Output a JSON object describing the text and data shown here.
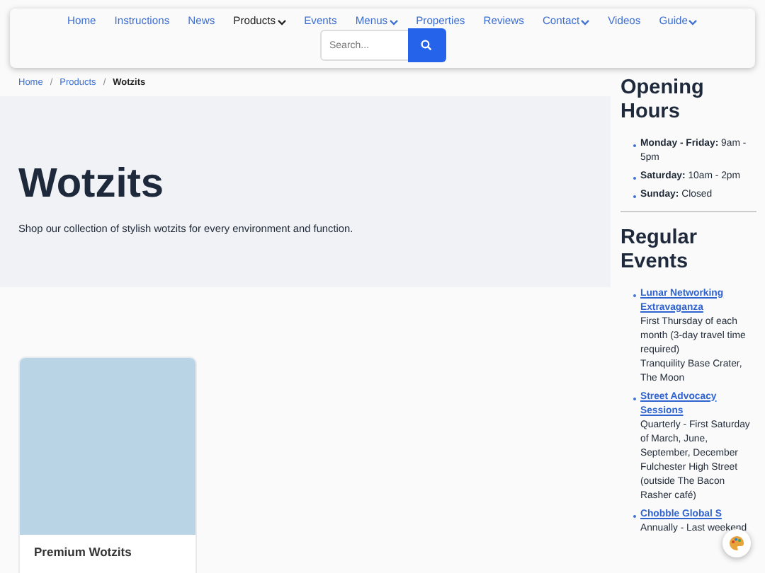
{
  "nav": {
    "items": [
      {
        "label": "Home",
        "selected": false,
        "dropdown": false
      },
      {
        "label": "Instructions",
        "selected": false,
        "dropdown": false
      },
      {
        "label": "News",
        "selected": false,
        "dropdown": false
      },
      {
        "label": "Products",
        "selected": true,
        "dropdown": true
      },
      {
        "label": "Events",
        "selected": false,
        "dropdown": false
      },
      {
        "label": "Menus",
        "selected": false,
        "dropdown": true
      },
      {
        "label": "Properties",
        "selected": false,
        "dropdown": false
      },
      {
        "label": "Reviews",
        "selected": false,
        "dropdown": false
      },
      {
        "label": "Contact",
        "selected": false,
        "dropdown": true
      },
      {
        "label": "Videos",
        "selected": false,
        "dropdown": false
      },
      {
        "label": "Guide",
        "selected": false,
        "dropdown": true
      }
    ],
    "search": {
      "placeholder": "Search..."
    }
  },
  "breadcrumb": [
    {
      "label": "Home",
      "current": false
    },
    {
      "separator": "/",
      "label": "Products",
      "current": false
    },
    {
      "separator": "/",
      "label": "Wotzits",
      "current": true
    }
  ],
  "hero": {
    "title": "Wotzits",
    "text": "Shop our collection of stylish wotzits for every environment and function."
  },
  "products": [
    {
      "kind": "picture",
      "title": "Premium Wotzits"
    }
  ],
  "sidebar": {
    "hours": {
      "title": "Opening Hours",
      "items": [
        "**Monday - Friday:** 9am - 5pm",
        "**Saturday:** 10am - 2pm",
        "**Sunday:** Closed"
      ]
    },
    "events": {
      "title": "Regular Events",
      "items": [
        {
          "title": "Lunar Networking Extravaganza",
          "lines": [
            "First Thursday of each month (3-day travel time required)",
            "Tranquility Base Crater, The Moon"
          ]
        },
        {
          "title": "Street Advocacy Sessions",
          "lines": [
            "Quarterly - First Saturday of March, June, September, December",
            "Fulchester High Street (outside The Bacon Rasher café)"
          ]
        },
        {
          "title": "Chobble Global S",
          "lines": [
            "Annually - Last weekend"
          ]
        }
      ]
    }
  }
}
